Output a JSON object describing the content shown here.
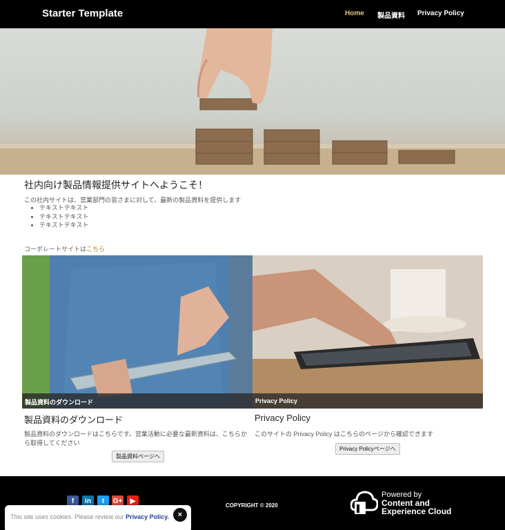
{
  "navbar": {
    "brand": "Starter Template",
    "links": [
      {
        "label": "Home",
        "active": true
      },
      {
        "label": "製品資料",
        "active": false
      },
      {
        "label": "Privacy Policy",
        "active": false
      }
    ]
  },
  "intro": {
    "title": "社内向け製品情報提供サイトへようこそ！",
    "text": "この社内サイトは、営業部門の皆さまに対して、最新の製品資料を提供します",
    "items": [
      "テキストテキスト",
      "テキストテキスト",
      "テキストテキスト"
    ],
    "corp_prefix": "コーポレートサイトは",
    "corp_link": "こちら"
  },
  "cards": [
    {
      "caption": "製品資料のダウンロード",
      "title": "製品資料のダウンロード",
      "text": "製品資料のダウンロードはこちらです。営業活動に必要な最新資料は、こちらから取得してください",
      "button": "製品資料ページへ"
    },
    {
      "caption": "Privacy Policy",
      "title": "Privacy Policy",
      "text": "このサイトの Privacy Policy はこちらのページから確認できます",
      "button": "Privacy Policyページへ"
    }
  ],
  "footer": {
    "social": [
      {
        "icon": "facebook-icon",
        "glyph": "f",
        "color": "#3b5998"
      },
      {
        "icon": "linkedin-icon",
        "glyph": "in",
        "color": "#0e76a8"
      },
      {
        "icon": "twitter-icon",
        "glyph": "t",
        "color": "#1da1f2"
      },
      {
        "icon": "google-plus-icon",
        "glyph": "G+",
        "color": "#dd4b39"
      },
      {
        "icon": "youtube-icon",
        "glyph": "▶",
        "color": "#e62117"
      }
    ],
    "copyright": "COPYRIGHT © 2020",
    "powered": {
      "line1": "Powered by",
      "line2": "Content and",
      "line3": "Experience Cloud"
    }
  },
  "cookie": {
    "text": "This site uses cookies. Please review our ",
    "link": "Privacy Policy.",
    "close": "×"
  }
}
